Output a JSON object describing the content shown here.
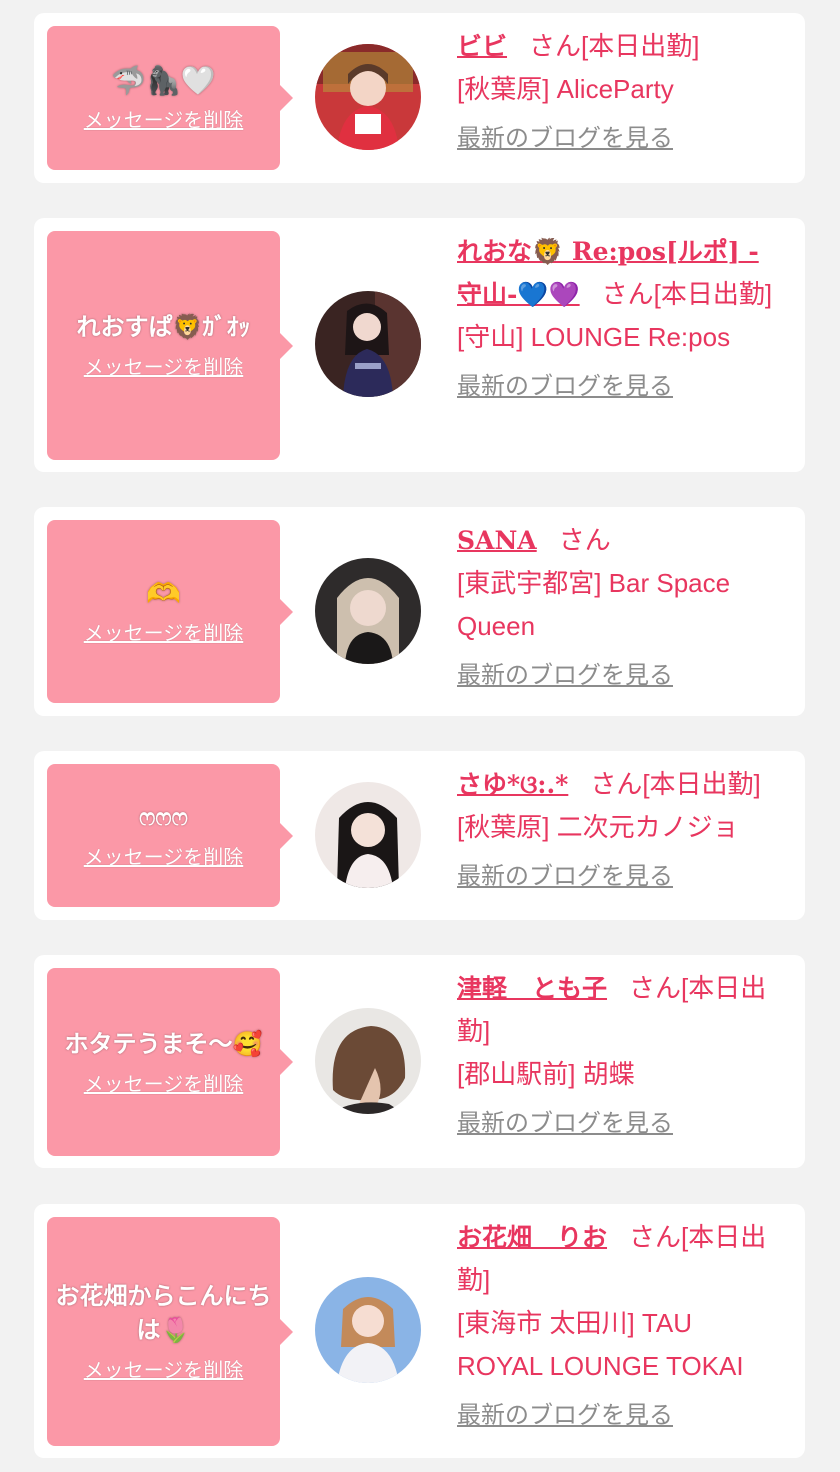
{
  "delete_label": "メッセージを削除",
  "blog_label": "最新のブログを見る",
  "colors": {
    "bubble": "#fb98a7",
    "accent": "#e8365f",
    "muted": "#8c8c8c",
    "background": "#f2f2f2",
    "card": "#ffffff"
  },
  "cards": [
    {
      "message": "🦈🦍🤍",
      "name": "ビビ",
      "suffix": "さん[本日出勤]",
      "shop": "[秋葉原] AliceParty",
      "avatar_icon": "avatar-photo-red-dress"
    },
    {
      "message": "れおすぱ🦁ｶﾞｵｯ",
      "name": "れおな🦁 Re:pos[ルポ] -守山-💙💜",
      "suffix": "さん[本日出勤]",
      "shop": "[守山] LOUNGE Re:pos",
      "avatar_icon": "avatar-photo-dark-dress"
    },
    {
      "message": "🫶",
      "name": "SANA",
      "suffix": "さん",
      "shop": "[東武宇都宮] Bar Space Queen",
      "avatar_icon": "avatar-photo-blonde"
    },
    {
      "message": "ෆෆෆ",
      "name": "さゆ*ଓ:.*",
      "suffix": "さん[本日出勤]",
      "shop": "[秋葉原] 二次元カノジョ",
      "avatar_icon": "avatar-photo-black-hair"
    },
    {
      "message": "ホタテうまそ〜🥰",
      "name": "津軽　とも子",
      "suffix": "さん[本日出勤]",
      "shop": "[郡山駅前] 胡蝶",
      "avatar_icon": "avatar-photo-short-hair"
    },
    {
      "message": "お花畑からこんにちは🌷",
      "name": "お花畑　りお",
      "suffix": "さん[本日出勤]",
      "shop": "[東海市 太田川] TAU ROYAL LOUNGE TOKAI",
      "avatar_icon": "avatar-photo-blue-bg"
    }
  ]
}
